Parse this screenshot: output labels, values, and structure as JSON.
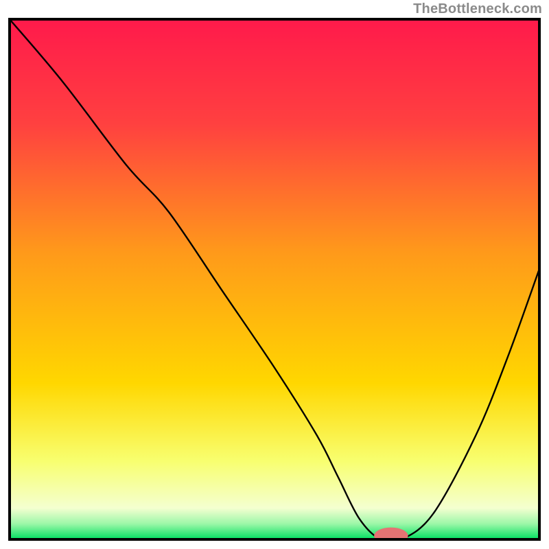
{
  "watermark": "TheBottleneck.com",
  "chart_data": {
    "type": "line",
    "title": "",
    "xlabel": "",
    "ylabel": "",
    "xlim": [
      0,
      100
    ],
    "ylim": [
      0,
      100
    ],
    "grid": false,
    "legend": false,
    "background_gradient": {
      "type": "vertical",
      "stops": [
        {
          "offset": 0.0,
          "color": "#ff1a4b"
        },
        {
          "offset": 0.2,
          "color": "#ff4040"
        },
        {
          "offset": 0.45,
          "color": "#ff9a1a"
        },
        {
          "offset": 0.7,
          "color": "#ffd700"
        },
        {
          "offset": 0.85,
          "color": "#f8ff70"
        },
        {
          "offset": 0.94,
          "color": "#f4ffd0"
        },
        {
          "offset": 0.97,
          "color": "#9cf7a8"
        },
        {
          "offset": 1.0,
          "color": "#00e060"
        }
      ]
    },
    "series": [
      {
        "name": "bottleneck-curve",
        "color": "#000000",
        "width": 2.4,
        "x": [
          0,
          10,
          22,
          30,
          40,
          50,
          58,
          62,
          66,
          70,
          74,
          80,
          88,
          94,
          100
        ],
        "y": [
          100,
          88,
          72,
          63,
          48,
          33,
          20,
          12,
          4,
          0,
          0,
          5,
          20,
          35,
          52
        ]
      }
    ],
    "marker": {
      "name": "selected-point",
      "x": 72,
      "y": 0.7,
      "rx": 3.2,
      "ry": 1.6,
      "color": "#e57373"
    },
    "frame": {
      "color": "#000000",
      "width": 4
    }
  }
}
